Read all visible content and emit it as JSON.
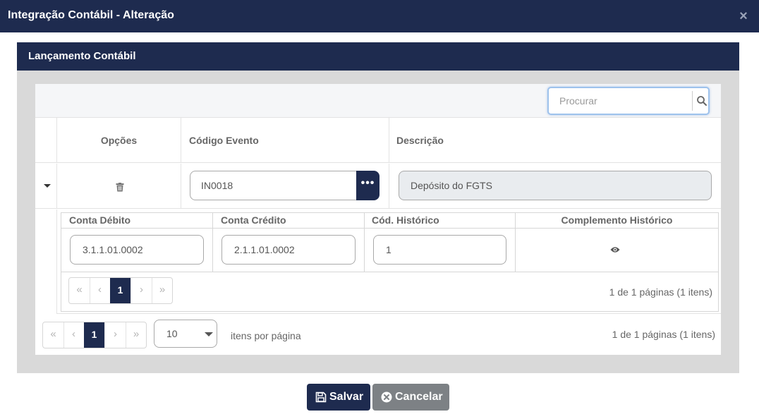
{
  "modal": {
    "title": "Integração Contábil - Alteração",
    "close_glyph": "×"
  },
  "panel": {
    "title": "Lançamento Contábil"
  },
  "search": {
    "placeholder": "Procurar"
  },
  "columns": {
    "options": "Opções",
    "event_code": "Código Evento",
    "description": "Descrição"
  },
  "row": {
    "event_code": "IN0018",
    "description": "Depósito do FGTS",
    "lookup_glyph": "•••"
  },
  "detail": {
    "columns": {
      "debit": "Conta Débito",
      "credit": "Conta Crédito",
      "history_code": "Cód. Histórico",
      "history_complement": "Complemento Histórico"
    },
    "row": {
      "debit": "3.1.1.01.0002",
      "credit": "2.1.1.01.0002",
      "history_code": "1"
    },
    "pager": {
      "first": "«",
      "prev": "‹",
      "page": "1",
      "next": "›",
      "last": "»",
      "info": "1 de 1 páginas (1 itens)"
    }
  },
  "pager": {
    "first": "«",
    "prev": "‹",
    "page": "1",
    "next": "›",
    "last": "»",
    "page_size": "10",
    "per_page_label": "itens por página",
    "info": "1 de 1 páginas (1 itens)"
  },
  "buttons": {
    "save": "Salvar",
    "cancel": "Cancelar"
  },
  "colors": {
    "navy": "#1e2b4f",
    "cancel_gray": "#7d8185",
    "panel_gray": "#d9d9d9"
  }
}
